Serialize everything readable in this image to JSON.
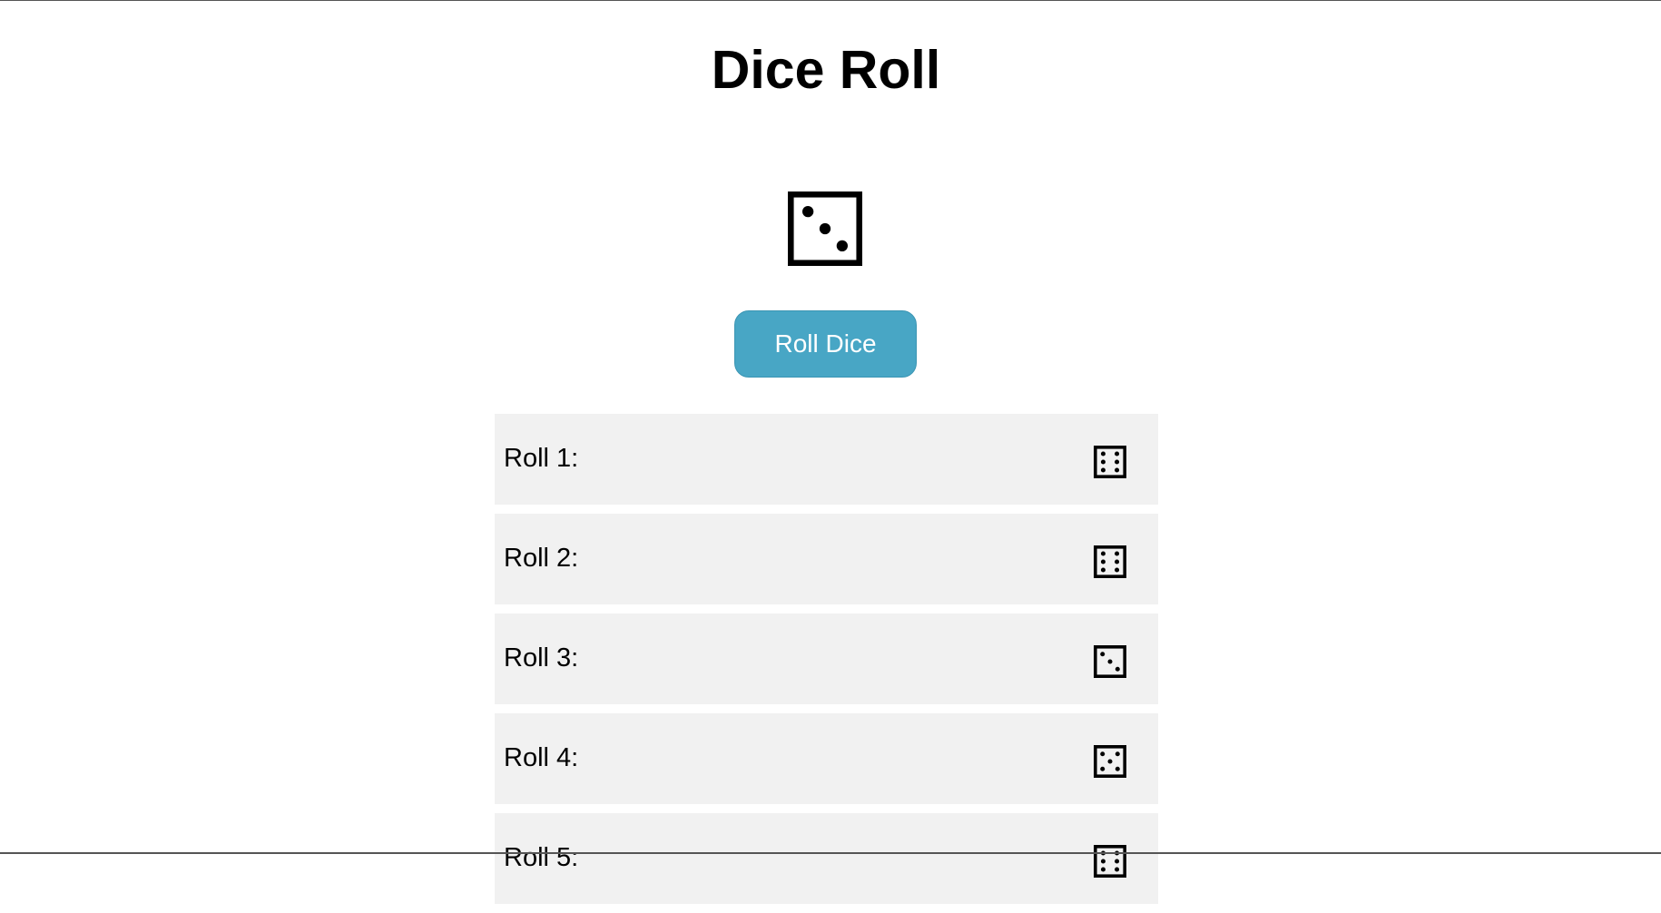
{
  "page": {
    "title": "Dice Roll"
  },
  "current_roll": {
    "value": 3,
    "icon": "die-face-3-icon"
  },
  "controls": {
    "roll_button_label": "Roll Dice"
  },
  "history": [
    {
      "label": "Roll 1:",
      "value": 6,
      "icon": "die-face-6-icon"
    },
    {
      "label": "Roll 2:",
      "value": 6,
      "icon": "die-face-6-icon"
    },
    {
      "label": "Roll 3:",
      "value": 3,
      "icon": "die-face-3-icon"
    },
    {
      "label": "Roll 4:",
      "value": 5,
      "icon": "die-face-5-icon"
    },
    {
      "label": "Roll 5:",
      "value": 6,
      "icon": "die-face-6-icon"
    }
  ],
  "colors": {
    "button": "#48a6c5",
    "button_text": "#ffffff",
    "row_background": "#f1f1f1"
  }
}
